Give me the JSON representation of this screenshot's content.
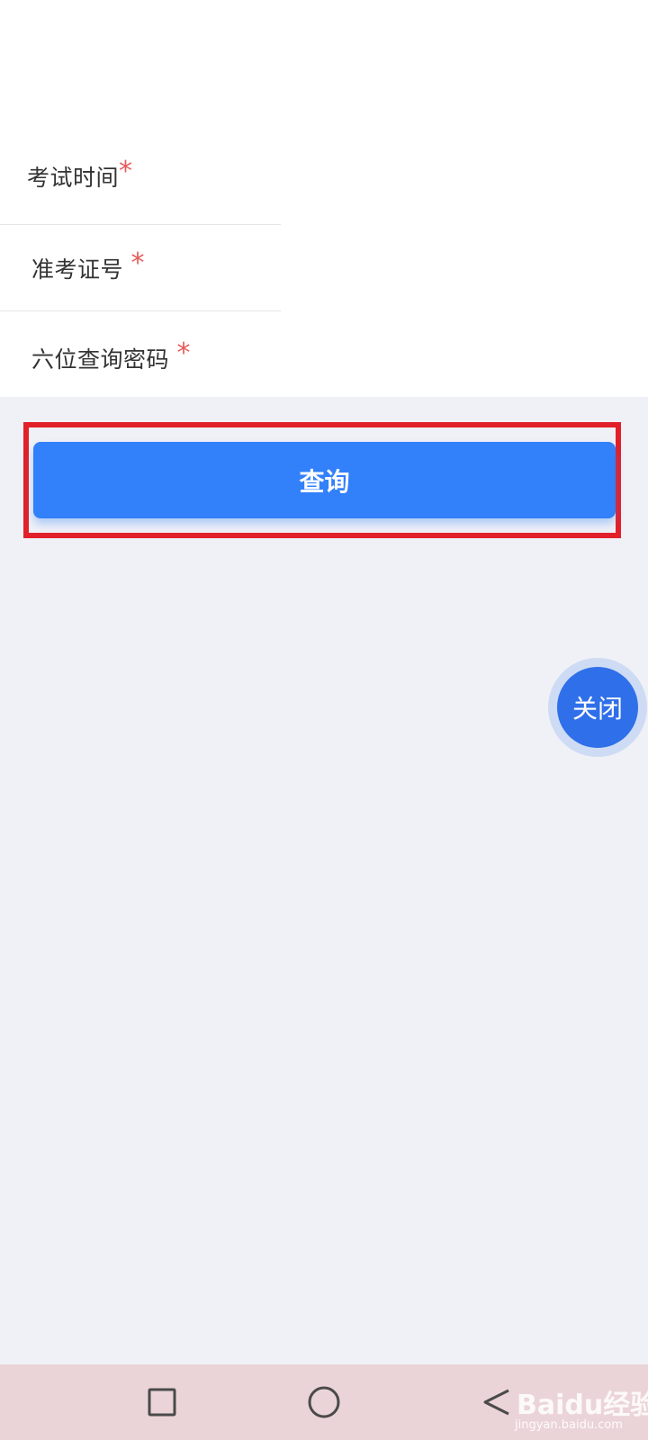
{
  "form": {
    "fields": [
      {
        "label": "考试时间",
        "required_mark": "*"
      },
      {
        "label": "准考证号",
        "required_mark": "*"
      },
      {
        "label": "六位查询密码",
        "required_mark": "*"
      }
    ]
  },
  "query_button": {
    "label": "查询"
  },
  "close_button": {
    "label": "关闭"
  },
  "nav": {
    "recents_icon": "square-icon",
    "home_icon": "circle-icon",
    "back_icon": "triangle-back-icon"
  },
  "watermark": {
    "brand": "Baidu经验",
    "url": "jingyan.baidu.com"
  },
  "colors": {
    "primary": "#3280fa",
    "required": "#e55b5b",
    "highlight": "#e2202a",
    "background": "#f0f1f6",
    "navbar": "#ebd4d8"
  }
}
